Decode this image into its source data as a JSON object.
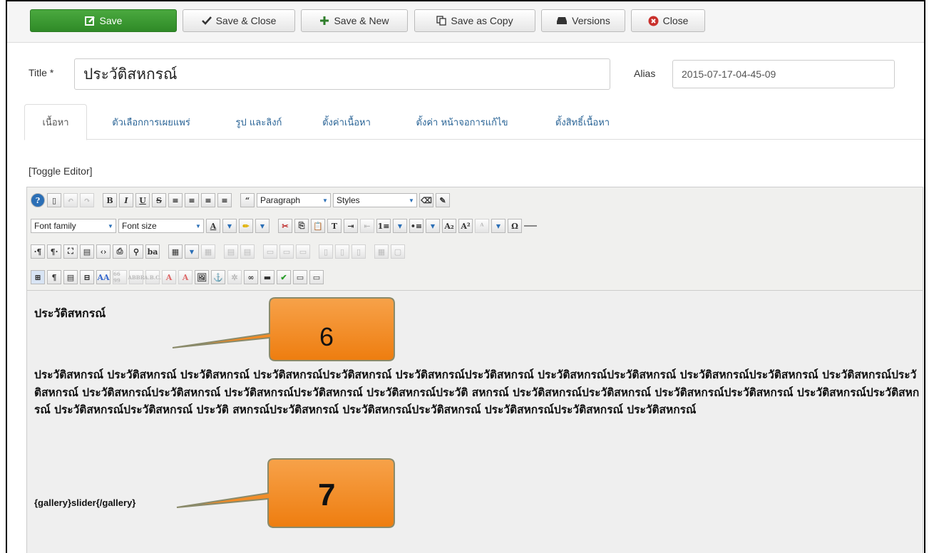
{
  "toolbar": {
    "save": "Save",
    "save_close": "Save & Close",
    "save_new": "Save & New",
    "save_copy": "Save as Copy",
    "versions": "Versions",
    "close": "Close"
  },
  "form": {
    "title_label": "Title *",
    "title_value": "ประวัติสหกรณ์",
    "alias_label": "Alias",
    "alias_value": "2015-07-17-04-45-09"
  },
  "tabs": [
    {
      "label": "เนื้อหา",
      "active": true
    },
    {
      "label": "ตัวเลือกการเผยแพร่"
    },
    {
      "label": "รูป และลิงก์"
    },
    {
      "label": "ตั้งค่าเนื้อหา"
    },
    {
      "label": "ตั้งค่า หน้าจอการแก้ไข"
    },
    {
      "label": "ตั้งสิทธิ์เนื้อหา"
    }
  ],
  "editor": {
    "toggle": "[Toggle Editor]",
    "format_select": "Paragraph",
    "styles_select": "Styles",
    "font_family": "Font family",
    "font_size": "Font size",
    "heading": "ประวัติสหกรณ์",
    "paragraph": "ประวัติสหกรณ์ ประวัติสหกรณ์ ประวัติสหกรณ์ ประวัติสหกรณ์ประวัติสหกรณ์ ประวัติสหกรณ์ประวัติสหกรณ์ ประวัติสหกรณ์ประวัติสหกรณ์ ประวัติสหกรณ์ประวัติสหกรณ์ ประวัติสหกรณ์ประวัติสหกรณ์ ประวัติสหกรณ์ประวัติสหกรณ์ ประวัติสหกรณ์ประวัติสหกรณ์ ประวัติสหกรณ์ประวัติ สหกรณ์ ประวัติสหกรณ์ประวัติสหกรณ์ ประวัติสหกรณ์ประวัติสหกรณ์ ประวัติสหกรณ์ประวัติสหกรณ์ ประวัติสหกรณ์ประวัติสหกรณ์ ประวัติ สหกรณ์ประวัติสหกรณ์ ประวัติสหกรณ์ประวัติสหกรณ์ ประวัติสหกรณ์ประวัติสหกรณ์ ประวัติสหกรณ์",
    "gallery_tag": "{gallery}slider{/gallery}"
  },
  "callouts": [
    {
      "number": "6"
    },
    {
      "number": "7"
    }
  ],
  "colors": {
    "save_green": "#3d9b33",
    "callout_orange": "#f48c1a",
    "link_blue": "#2a6496"
  }
}
